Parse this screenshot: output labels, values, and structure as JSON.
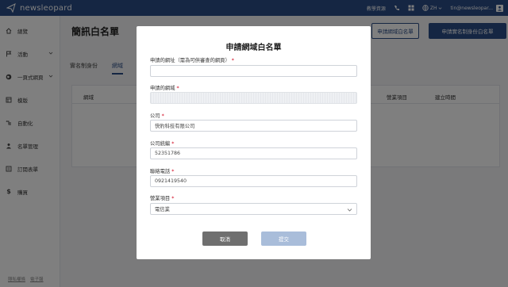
{
  "app": {
    "logo_text": "newsleopard"
  },
  "topbar": {
    "help_label": "教學資源",
    "lang_label": "ZH",
    "user_email": "tin@newsleopar..."
  },
  "sidebar": {
    "items": [
      {
        "label": "總覽",
        "icon": "home-icon"
      },
      {
        "label": "活動",
        "icon": "flag-icon"
      },
      {
        "label": "一頁式網頁",
        "icon": "globe-icon"
      },
      {
        "label": "模版",
        "icon": "template-icon"
      },
      {
        "label": "自動化",
        "icon": "automation-icon"
      },
      {
        "label": "名單管理",
        "icon": "contacts-icon"
      },
      {
        "label": "訂閱表單",
        "icon": "form-icon"
      },
      {
        "label": "購買",
        "icon": "dollar-icon"
      }
    ],
    "footer": {
      "privacy": "隱私權條",
      "epaper": "電子報"
    }
  },
  "main": {
    "title": "簡訊白名單",
    "btn_domain": "申請網域白名單",
    "btn_identity": "申請實名制身份白名單",
    "tabs": [
      {
        "label": "實名制身份"
      },
      {
        "label": "網域"
      }
    ],
    "table_headers": {
      "domain": "網域",
      "business": "營業項目",
      "created": "建立時間"
    }
  },
  "modal": {
    "title": "申請網域白名單",
    "fields": {
      "url_label": "申請的網址（需為可供審查的網頁）",
      "url_value": "",
      "domain_label": "申請的網域",
      "domain_value": "",
      "company_label": "公司",
      "company_value": "快豹科技有限公司",
      "tax_label": "公司統編",
      "tax_value": "52351786",
      "phone_label": "聯絡電話",
      "phone_value": "0921419540",
      "business_label": "營業項目",
      "business_value": "電信業"
    },
    "required_mark": "*",
    "cancel_label": "取消",
    "submit_label": "提交"
  },
  "colors": {
    "primary": "#2b4d87",
    "required": "#d0021b",
    "overlay": "rgba(0,0,0,0.5)",
    "cancel": "#6f6f6f",
    "submit_disabled": "#a9bdda"
  }
}
